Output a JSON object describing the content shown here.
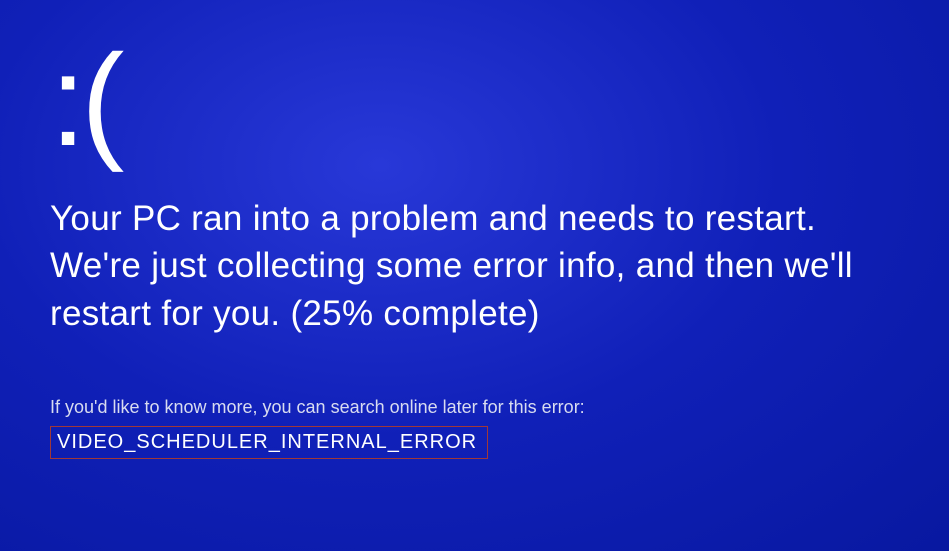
{
  "bsod": {
    "sad_face": ":(",
    "main_message": "Your PC ran into a problem and needs to restart. We're just collecting some error info, and then we'll restart for you. (25% complete)",
    "info_text": "If you'd like to know more, you can search online later for this error:",
    "error_code": "VIDEO_SCHEDULER_INTERNAL_ERROR",
    "progress_percent": 25
  }
}
